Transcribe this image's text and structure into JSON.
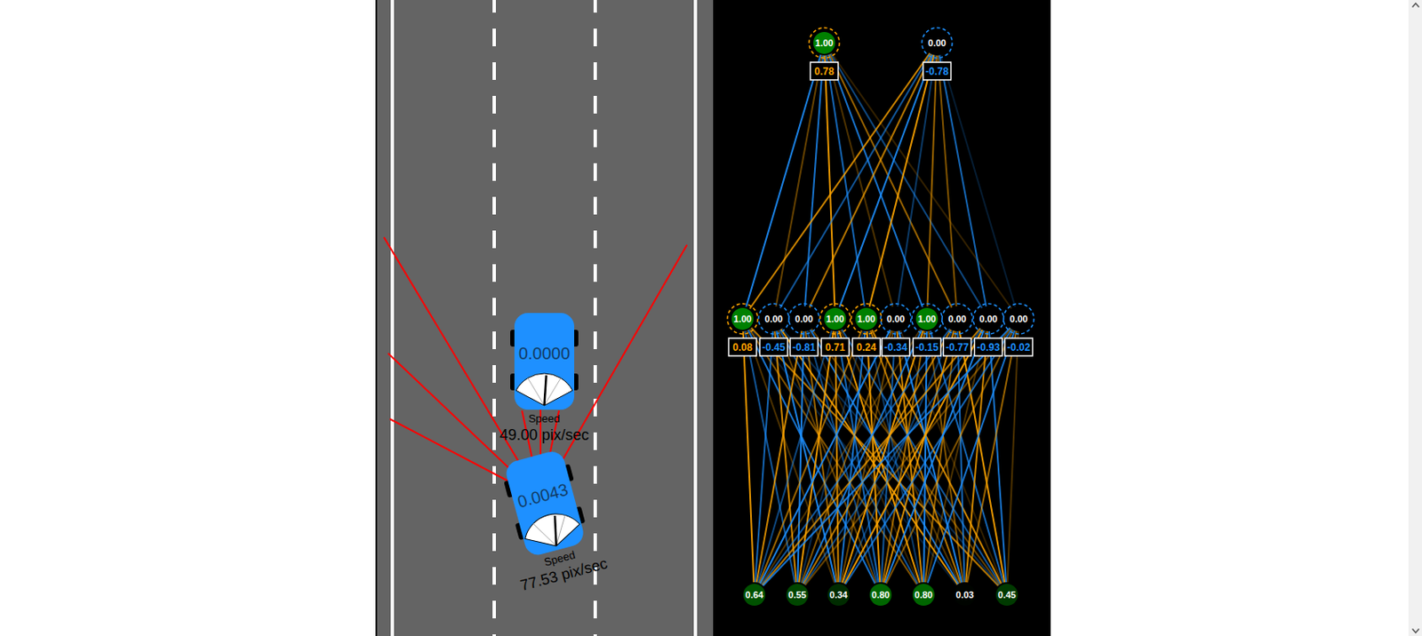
{
  "cars": [
    {
      "kind": "traffic",
      "label": "0.0000",
      "speed_label": "Speed",
      "speed": "49.00 pix/sec",
      "gauge_level": 0.53
    },
    {
      "kind": "player",
      "label": "0.0043",
      "speed_label": "Speed",
      "speed": "77.53 pix/sec",
      "gauge_level": 0.6
    }
  ],
  "network": {
    "outputs": [
      {
        "value": "1.00",
        "level": 1,
        "bias": "0.78",
        "bias_level": 0.78
      },
      {
        "value": "0.00",
        "level": 0,
        "bias": "-0.78",
        "bias_level": -0.78
      }
    ],
    "hidden": [
      {
        "value": "1.00",
        "level": 1,
        "bias": "0.08",
        "bias_level": 0.08
      },
      {
        "value": "0.00",
        "level": 0,
        "bias": "-0.45",
        "bias_level": -0.45
      },
      {
        "value": "0.00",
        "level": 0,
        "bias": "-0.81",
        "bias_level": -0.81
      },
      {
        "value": "1.00",
        "level": 1,
        "bias": "0.71",
        "bias_level": 0.71
      },
      {
        "value": "1.00",
        "level": 1,
        "bias": "0.24",
        "bias_level": 0.24
      },
      {
        "value": "0.00",
        "level": 0,
        "bias": "-0.34",
        "bias_level": -0.34
      },
      {
        "value": "1.00",
        "level": 1,
        "bias": "-0.15",
        "bias_level": -0.15
      },
      {
        "value": "0.00",
        "level": 0,
        "bias": "-0.77",
        "bias_level": -0.77
      },
      {
        "value": "0.00",
        "level": 0,
        "bias": "-0.93",
        "bias_level": -0.93
      },
      {
        "value": "0.00",
        "level": 0,
        "bias": "-0.02",
        "bias_level": -0.02
      }
    ],
    "inputs": [
      {
        "value": "0.64",
        "level": 0.64
      },
      {
        "value": "0.55",
        "level": 0.55
      },
      {
        "value": "0.34",
        "level": 0.34
      },
      {
        "value": "0.80",
        "level": 0.8
      },
      {
        "value": "0.80",
        "level": 0.8
      },
      {
        "value": "0.03",
        "level": 0.03
      },
      {
        "value": "0.45",
        "level": 0.45
      }
    ],
    "weights_input_hidden": [
      [
        0.9,
        -0.6,
        0.3,
        -0.8,
        0.5,
        -0.2,
        0.7
      ],
      [
        -0.7,
        0.8,
        -0.9,
        0.4,
        -0.6,
        0.9,
        -0.3
      ],
      [
        0.8,
        -0.9,
        0.6,
        -0.5,
        0.2,
        -0.8,
        0.4
      ],
      [
        -0.5,
        0.9,
        0.8,
        -0.7,
        0.9,
        0.3,
        -0.6
      ],
      [
        0.6,
        -0.3,
        -0.8,
        0.9,
        -0.4,
        0.7,
        0.8
      ],
      [
        -0.9,
        0.5,
        0.4,
        -0.6,
        0.8,
        -0.9,
        0.2
      ],
      [
        0.3,
        -0.8,
        0.9,
        0.6,
        -0.9,
        0.5,
        -0.7
      ],
      [
        -0.6,
        0.7,
        -0.4,
        0.8,
        0.6,
        -0.7,
        0.9
      ],
      [
        0.7,
        -0.5,
        0.9,
        -0.9,
        0.3,
        0.8,
        -0.8
      ],
      [
        -0.8,
        0.4,
        -0.7,
        0.5,
        -0.8,
        0.6,
        0.3
      ]
    ],
    "weights_hidden_output": [
      [
        -0.9,
        0.4,
        -0.8,
        0.9,
        -0.7,
        0.3,
        -0.8,
        0.6,
        -0.5,
        0.2
      ],
      [
        0.8,
        -0.6,
        0.7,
        -0.9,
        0.9,
        -0.4,
        0.6,
        0.5,
        -0.7,
        -0.2
      ]
    ]
  }
}
